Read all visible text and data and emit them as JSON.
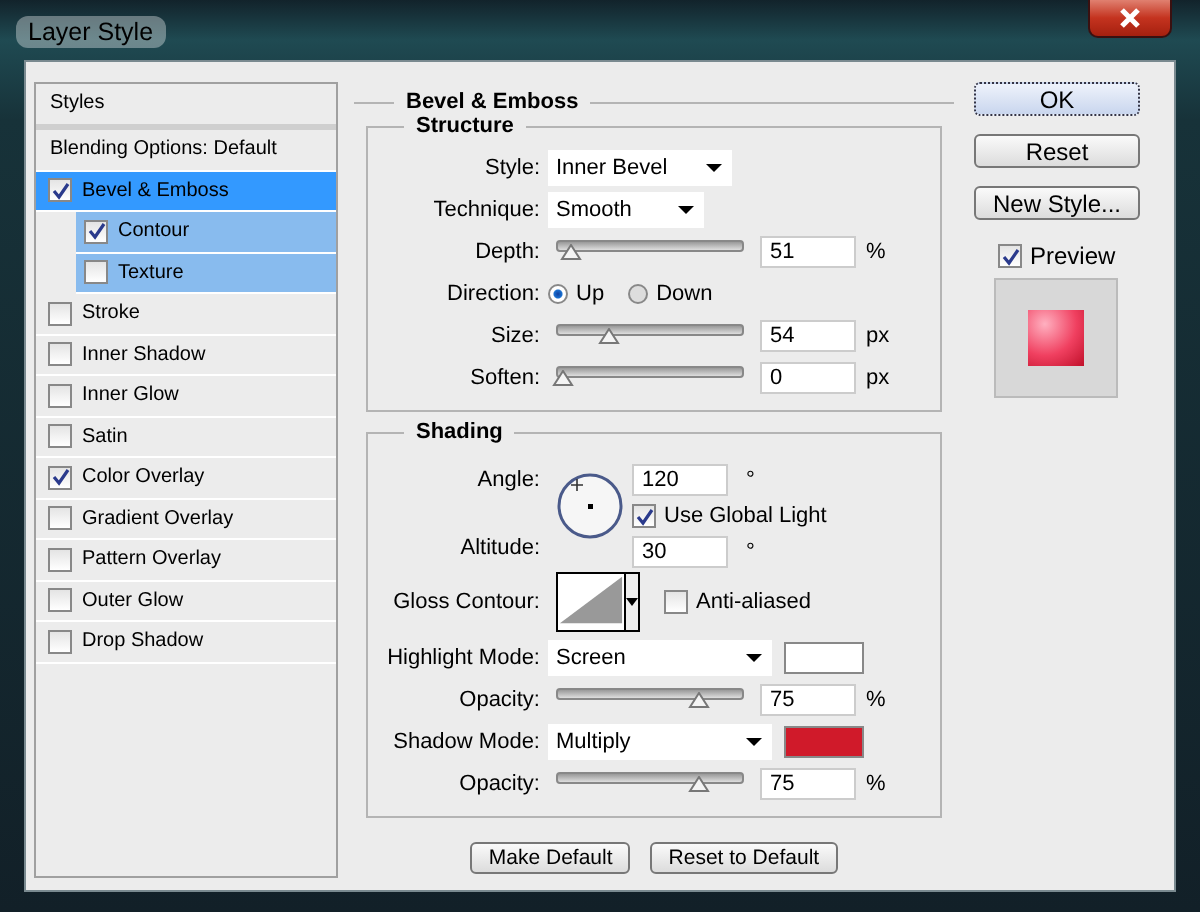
{
  "window": {
    "title": "Layer Style"
  },
  "styles_panel": {
    "header": "Styles",
    "blending_options": "Blending Options: Default",
    "items": [
      {
        "label": "Bevel & Emboss",
        "checked": true,
        "selected": true,
        "children": [
          {
            "label": "Contour",
            "checked": true,
            "selected": false
          },
          {
            "label": "Texture",
            "checked": false,
            "selected": false
          }
        ]
      },
      {
        "label": "Stroke",
        "checked": false,
        "selected": false
      },
      {
        "label": "Inner Shadow",
        "checked": false,
        "selected": false
      },
      {
        "label": "Inner Glow",
        "checked": false,
        "selected": false
      },
      {
        "label": "Satin",
        "checked": false,
        "selected": false
      },
      {
        "label": "Color Overlay",
        "checked": true,
        "selected": false
      },
      {
        "label": "Gradient Overlay",
        "checked": false,
        "selected": false
      },
      {
        "label": "Pattern Overlay",
        "checked": false,
        "selected": false
      },
      {
        "label": "Outer Glow",
        "checked": false,
        "selected": false
      },
      {
        "label": "Drop Shadow",
        "checked": false,
        "selected": false
      }
    ]
  },
  "bevel_emboss": {
    "title": "Bevel & Emboss",
    "structure": {
      "title": "Structure",
      "rows": [
        {
          "kind": "dropdown",
          "label": "Style:",
          "value": "Inner Bevel"
        },
        {
          "kind": "dropdown",
          "label": "Technique:",
          "value": "Smooth"
        },
        {
          "kind": "slider",
          "label": "Depth:",
          "level": 0.04,
          "value": "51",
          "unit": "%"
        },
        {
          "kind": "radio",
          "label": "Direction:",
          "options": [
            {
              "label": "Up",
              "selected": true
            },
            {
              "label": "Down",
              "selected": false
            }
          ]
        },
        {
          "kind": "slider",
          "label": "Size:",
          "level": 0.25,
          "value": "54",
          "unit": "px"
        },
        {
          "kind": "slider",
          "label": "Soften:",
          "level": 0,
          "value": "0",
          "unit": "px"
        }
      ]
    },
    "shading": {
      "title": "Shading",
      "angle_label": "Angle:",
      "angle": "120",
      "angle_unit": "°",
      "use_global_light": {
        "label": "Use Global Light",
        "checked": true
      },
      "altitude_label": "Altitude:",
      "altitude": "30",
      "altitude_unit": "°",
      "gloss_contour_label": "Gloss Contour:",
      "anti_aliased": {
        "label": "Anti-aliased",
        "checked": false
      },
      "rows": [
        {
          "kind": "mode",
          "label": "Highlight Mode:",
          "value": "Screen",
          "color": "#ffffff"
        },
        {
          "kind": "slider",
          "label": "Opacity:",
          "level": 0.74,
          "value": "75",
          "unit": "%"
        },
        {
          "kind": "mode",
          "label": "Shadow Mode:",
          "value": "Multiply",
          "color": "#d01a2a"
        },
        {
          "kind": "slider",
          "label": "Opacity:",
          "level": 0.74,
          "value": "75",
          "unit": "%"
        }
      ]
    },
    "buttons": [
      "Make Default",
      "Reset to Default"
    ]
  },
  "side_buttons": [
    {
      "label": "OK",
      "default": true
    },
    {
      "label": "Reset",
      "default": false
    },
    {
      "label": "New Style...",
      "default": false
    }
  ],
  "preview": {
    "label": "Preview",
    "checked": true
  }
}
